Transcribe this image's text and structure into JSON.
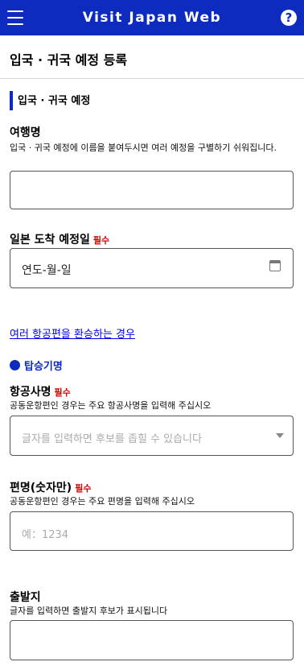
{
  "header": {
    "title": "Visit Japan Web"
  },
  "page": {
    "title": "입국 · 귀국 예정 등록"
  },
  "section": {
    "title": "입국 · 귀국 예정"
  },
  "required_label": "필수",
  "trip_name": {
    "label": "여행명",
    "description": "입국 · 귀국 예정에 이름을 붙여두시면 여러 예정을 구별하기 쉬워집니다.",
    "value": ""
  },
  "arrival_date": {
    "label": "일본 도착 예정일",
    "value": "연도-월-일"
  },
  "multi_flight_link": "여러 항공편을 환승하는 경우",
  "flight_section": {
    "title": "탑승기명"
  },
  "airline": {
    "label": "항공사명",
    "description": "공동운항편인 경우는 주요 항공사명을 입력해 주십시오",
    "placeholder": "글자를 입력하면 후보를 좁힐 수 있습니다"
  },
  "flight_number": {
    "label": "편명(숫자만)",
    "description": "공동운항편인 경우는 주요 편명을 입력해 주십시오",
    "placeholder": "예：1234"
  },
  "departure": {
    "label": "출발지",
    "description": "글자를 입력하면 출발지 후보가 표시됩니다",
    "value": ""
  }
}
